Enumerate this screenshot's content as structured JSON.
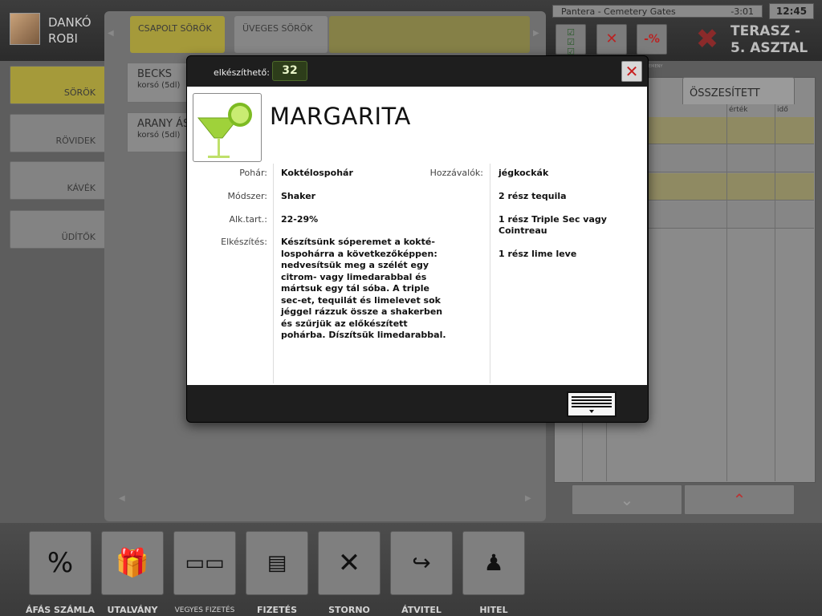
{
  "user": {
    "name": "DANKÓ\nROBI"
  },
  "categories": [
    {
      "label": "SÖRÖK",
      "selected": true
    },
    {
      "label": "RÖVIDEK",
      "selected": false
    },
    {
      "label": "KÁVÉK",
      "selected": false
    },
    {
      "label": "ÜDÍTŐK",
      "selected": false
    }
  ],
  "sub_tabs": [
    "CSAPOLT SÖRÖK",
    "ÜVEGES SÖRÖK"
  ],
  "products": [
    {
      "name": "BECKS",
      "size": "korsó (5dl)"
    },
    {
      "name": "ARANY ÁSZ",
      "size": "korsó (5dl)"
    }
  ],
  "now_playing": {
    "track": "Pantera - Cemetery Gates",
    "time": "-3:01"
  },
  "clock": "12:45",
  "table": {
    "label": "TERASZ -\n5. ASZTAL"
  },
  "order": {
    "summary_tab": "ÖSSZESÍTETT",
    "columns": [
      "érték",
      "idő"
    ],
    "hidden_tab_fragment": "EMENY"
  },
  "discount_label": "-%",
  "modal": {
    "available_label": "elkészíthető:",
    "available_qty": "32",
    "title": "MARGARITA",
    "fields": [
      {
        "label": "Pohár:",
        "value": "Koktélospohár"
      },
      {
        "label": "Módszer:",
        "value": "Shaker"
      },
      {
        "label": "Alk.tart.:",
        "value": "22-29%"
      },
      {
        "label": "Elkészítés:",
        "value": "Készítsünk sóperemet a kokté-\nlospohárra a következőképpen:\nnedvesítsük meg a szélét egy\ncitrom- vagy limedarabbal és\nmártsuk egy tál sóba. A triple\nsec-et, tequilát és limelevet sok\njéggel rázzuk össze a shakerben\nés szűrjük az előkészített\npohárba. Díszítsük limedarabbal."
      }
    ],
    "ingredients_label": "Hozzávalók:",
    "ingredients": [
      "jégkockák",
      "2 rész tequila",
      "1 rész Triple Sec vagy\nCointreau",
      "1 rész lime leve"
    ]
  },
  "toolbar": [
    {
      "label": "ÁFÁS SZÁMLA",
      "icon": "percent-icon"
    },
    {
      "label": "UTALVÁNY",
      "icon": "gift-icon"
    },
    {
      "label": "VEGYES FIZETÉS",
      "icon": "cards-icon"
    },
    {
      "label": "FIZETÉS",
      "icon": "banknotes-icon"
    },
    {
      "label": "STORNO",
      "icon": "storno-icon"
    },
    {
      "label": "ÁTVITEL",
      "icon": "transfer-icon"
    },
    {
      "label": "HITEL",
      "icon": "credit-icon"
    }
  ],
  "colors": {
    "accent": "#a59a3a",
    "close": "#c82020",
    "qty_bg": "#2d3d1a"
  }
}
